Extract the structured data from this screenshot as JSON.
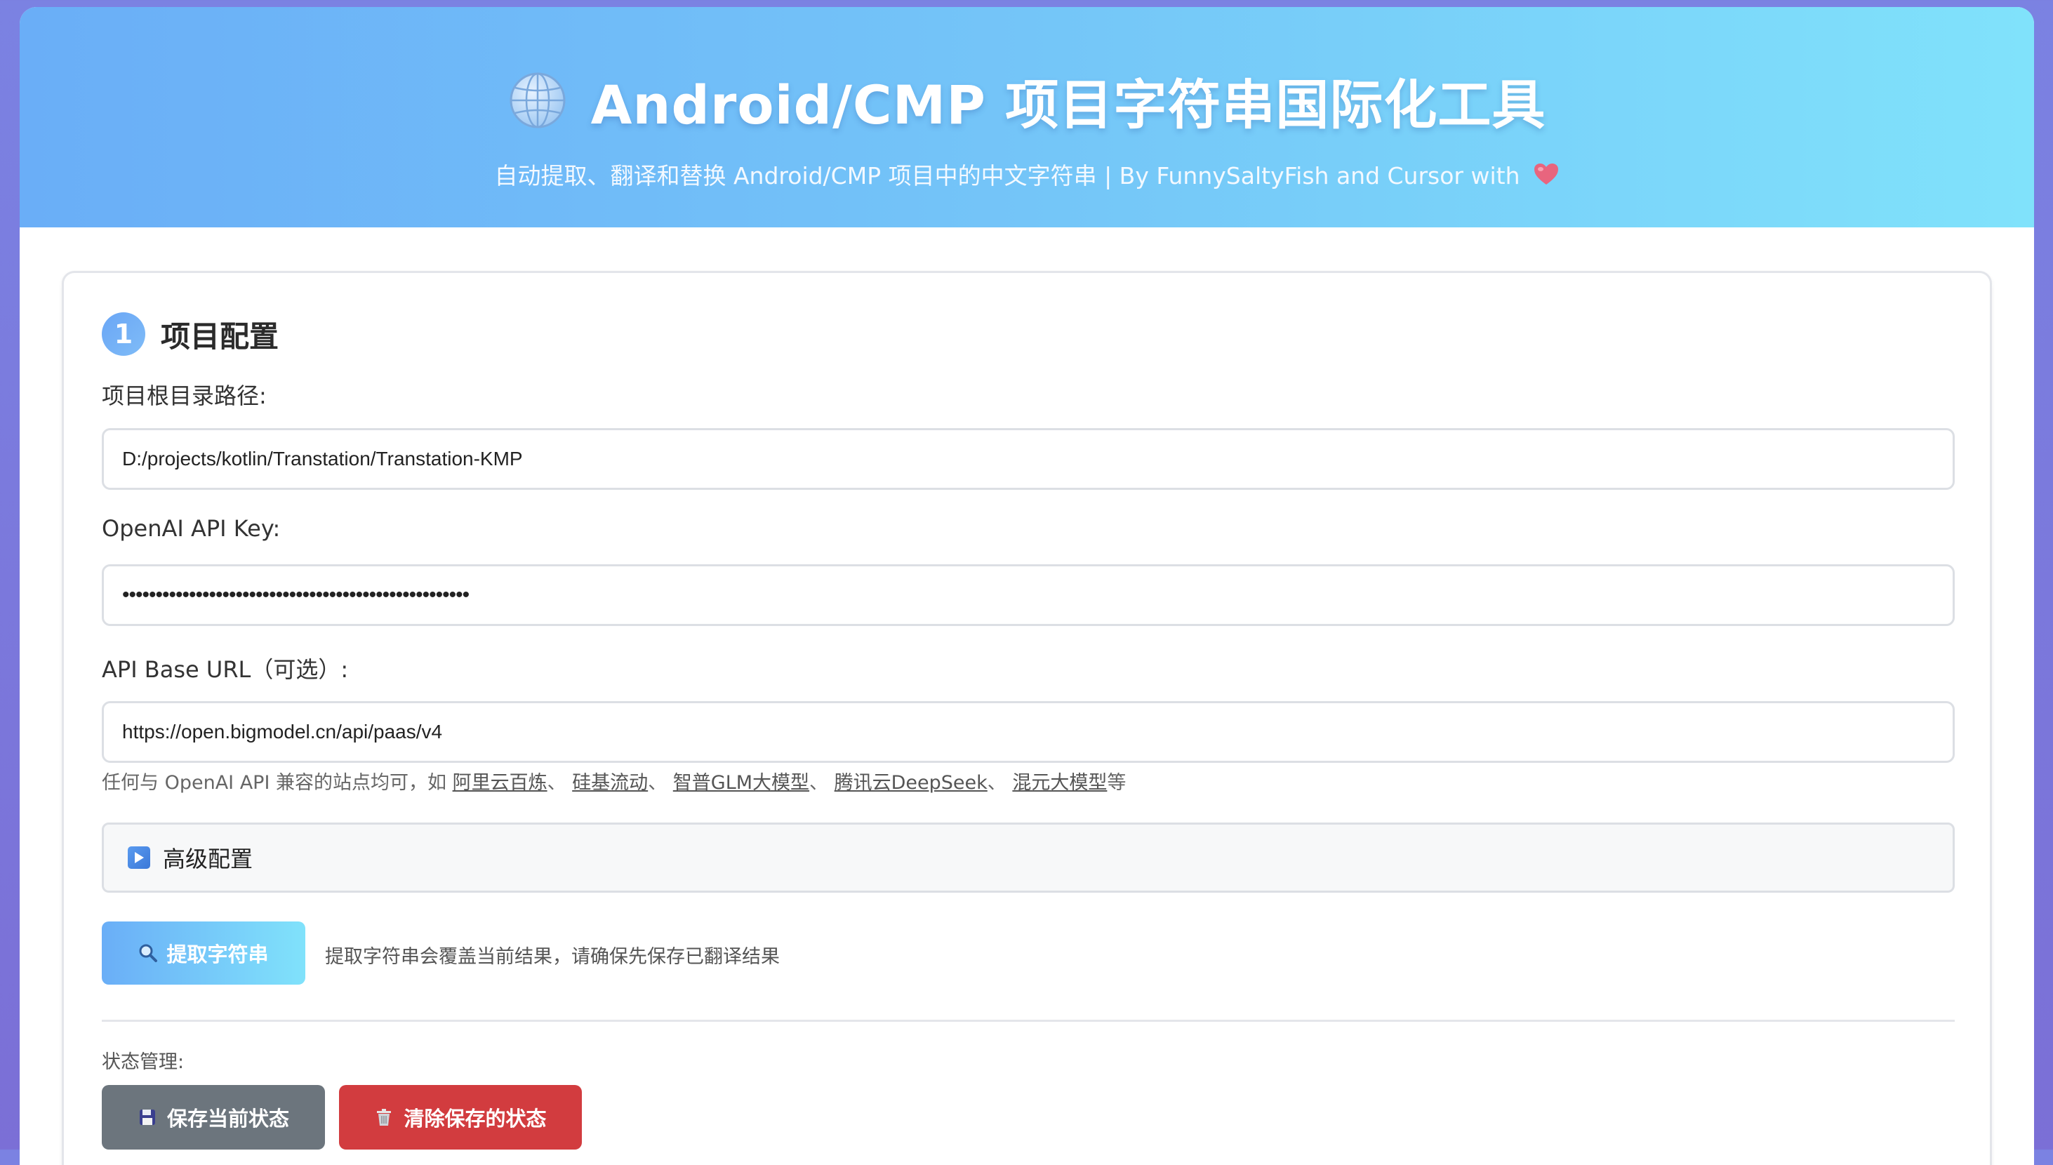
{
  "header": {
    "title": "Android/CMP 项目字符串国际化工具",
    "subtitle": "自动提取、翻译和替换 Android/CMP 项目中的中文字符串 | By FunnySaltyFish and Cursor with",
    "globe_icon": "globe-icon",
    "heart_icon": "heart-icon"
  },
  "section": {
    "step": "1",
    "title": "项目配置"
  },
  "fields": {
    "project_root_label": "项目根目录路径:",
    "project_root_value": "D:/projects/kotlin/Transtation/Transtation-KMP",
    "api_key_label": "OpenAI API Key:",
    "api_key_value": "••••••••••••••••••••••••••••••••••••••••••••••••••••",
    "base_url_label": "API Base URL（可选）:",
    "base_url_value": "https://open.bigmodel.cn/api/paas/v4"
  },
  "hint": {
    "prefix": "任何与 OpenAI API 兼容的站点均可，如 ",
    "links": [
      "阿里云百炼",
      "硅基流动",
      "智普GLM大模型",
      "腾讯云DeepSeek",
      "混元大模型"
    ],
    "separator": "、 ",
    "suffix": "等"
  },
  "advanced": {
    "label": "高级配置",
    "icon": "play-icon"
  },
  "actions": {
    "extract_label": "提取字符串",
    "extract_note": "提取字符串会覆盖当前结果，请确保先保存已翻译结果",
    "state_label": "状态管理:",
    "save_label": "保存当前状态",
    "clear_label": "清除保存的状态"
  },
  "colors": {
    "accent_start": "#6aaef7",
    "accent_end": "#80e2fb",
    "save_button": "#6c757d",
    "clear_button": "#d23c3f"
  }
}
